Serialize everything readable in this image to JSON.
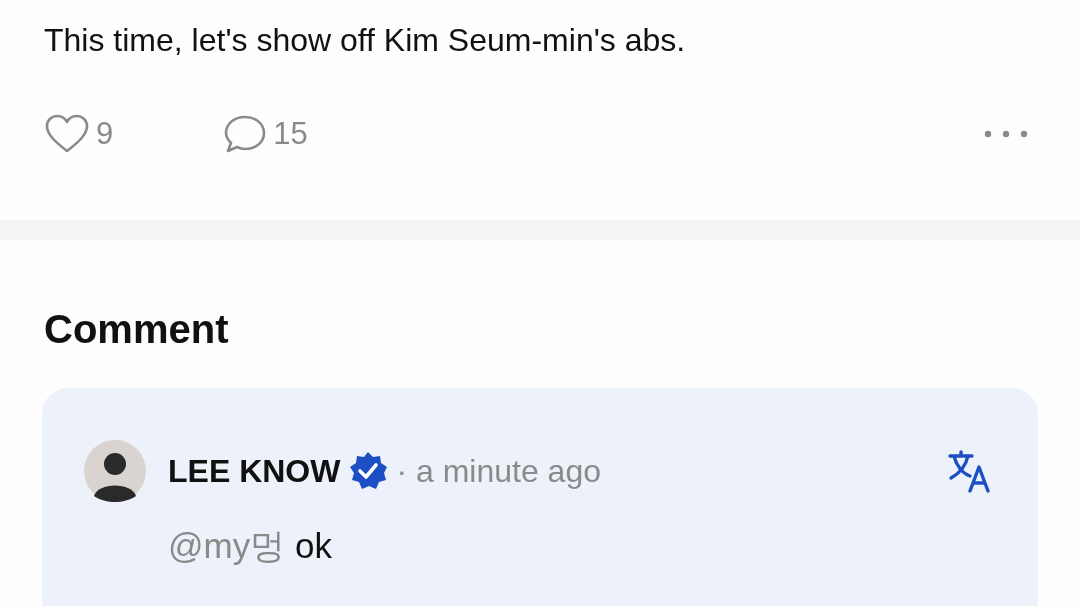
{
  "post": {
    "text": "This time, let's show off Kim Seum-min's abs.",
    "likes": "9",
    "comments": "15"
  },
  "comment_section": {
    "title": "Comment",
    "comments": [
      {
        "author": "LEE KNOW",
        "verified": true,
        "time": "· a minute ago",
        "mention": "@my멍",
        "text": "ok"
      }
    ]
  }
}
